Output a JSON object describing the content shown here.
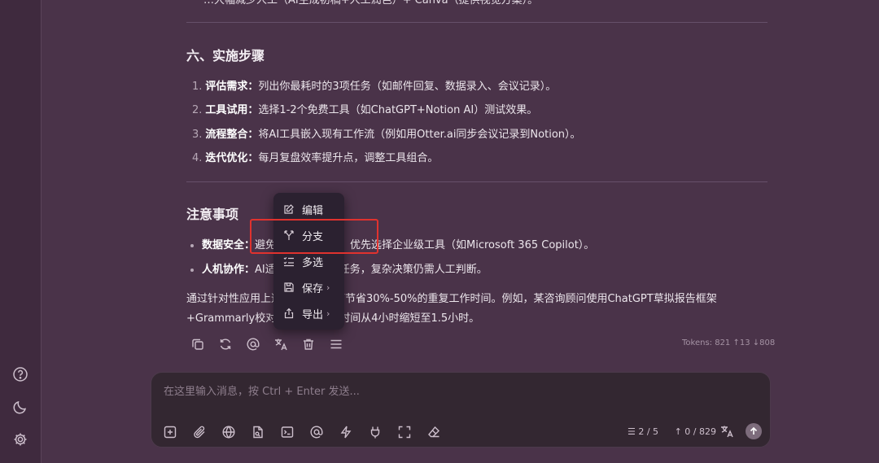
{
  "content": {
    "cut_line": "…大幅减少人工（AI生成初稿+人工润色）+ Canva（提供视觉方案）。",
    "section_six_title": "六、实施步骤",
    "steps": [
      {
        "num": "1.",
        "bold": "评估需求：",
        "text": "列出你最耗时的3项任务（如邮件回复、数据录入、会议记录）。"
      },
      {
        "num": "2.",
        "bold": "工具试用：",
        "text": "选择1-2个免费工具（如ChatGPT+Notion AI）测试效果。"
      },
      {
        "num": "3.",
        "bold": "流程整合：",
        "text": "将AI工具嵌入现有工作流（例如用Otter.ai同步会议记录到Notion）。"
      },
      {
        "num": "4.",
        "bold": "迭代优化：",
        "text": "每月复盘效率提升点，调整工具组合。"
      }
    ],
    "notes_title": "注意事项",
    "notes": [
      {
        "bold": "数据安全：",
        "text": "避免上传敏感信息，优先选择企业级工具（如Microsoft 365 Copilot）。"
      },
      {
        "bold": "人机协作：",
        "text": "AI适合处理标准化任务，复杂决策仍需人工判断。"
      }
    ],
    "paragraph": "通过针对性应用上述工具，通常可节省30%-50%的重复工作时间。例如，某咨询顾问使用ChatGPT草拟报告框架+Grammarly校对，将单份报告时间从4小时缩短至1.5小时。",
    "tokens": "Tokens: 821 ↑13 ↓808"
  },
  "context_menu": {
    "items": [
      {
        "label": "编辑",
        "icon": "edit-icon"
      },
      {
        "label": "分支",
        "icon": "branch-icon"
      },
      {
        "label": "多选",
        "icon": "multi-select-icon"
      },
      {
        "label": "保存",
        "icon": "save-icon",
        "has_submenu": true
      },
      {
        "label": "导出",
        "icon": "export-icon",
        "has_submenu": true
      }
    ],
    "highlighted": "分支",
    "highlight_color": "#e0322e"
  },
  "composer": {
    "placeholder": "在这里输入消息，按 Ctrl + Enter 发送...",
    "context_count": "2 / 5",
    "token_count": "0 / 829"
  },
  "colors": {
    "background": "#4a3349",
    "sidebar": "#3f2a3e",
    "menu_bg": "#2b2130",
    "composer_bg": "#332731"
  }
}
